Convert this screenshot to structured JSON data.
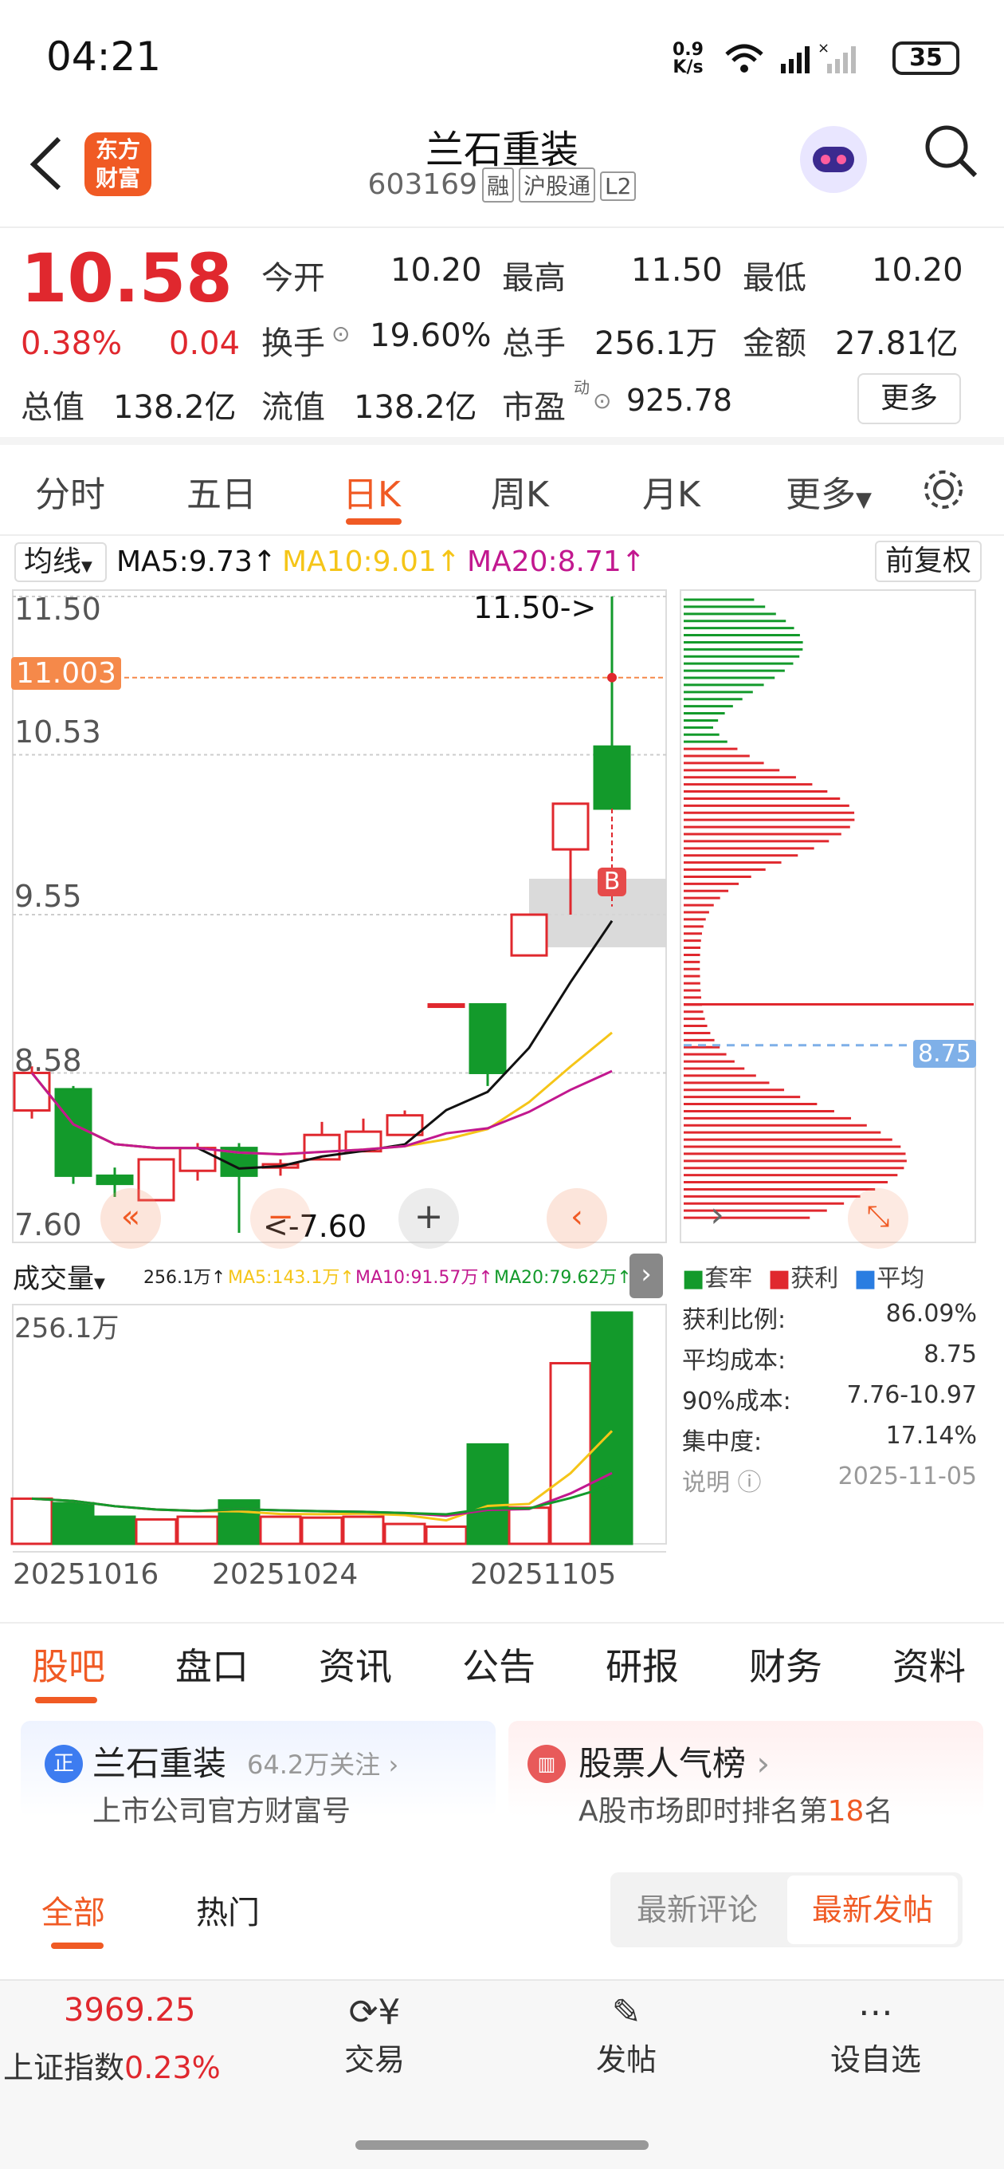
{
  "status": {
    "time": "04:21",
    "net_speed_top": "0.9",
    "net_speed_bottom": "K/s",
    "battery": "35"
  },
  "header": {
    "logo_line1": "东方",
    "logo_line2": "财富",
    "title": "兰石重装",
    "code": "603169",
    "tags": [
      "融",
      "沪股通",
      "L2"
    ]
  },
  "quote": {
    "price": "10.58",
    "change_pct": "0.38%",
    "change_amt": "0.04",
    "open_label": "今开",
    "open": "10.20",
    "high_label": "最高",
    "high": "11.50",
    "low_label": "最低",
    "low": "10.20",
    "turnover_label": "换手",
    "turnover": "19.60%",
    "volume_label": "总手",
    "volume": "256.1万",
    "amount_label": "金额",
    "amount": "27.81亿",
    "mktcap_label": "总值",
    "mktcap": "138.2亿",
    "float_label": "流值",
    "float_cap": "138.2亿",
    "pe_label": "市盈",
    "pe_sup": "动",
    "pe": "925.78",
    "more_label": "更多"
  },
  "ktabs": [
    "分时",
    "五日",
    "日K",
    "周K",
    "月K",
    "更多"
  ],
  "ma_bar": {
    "selector": "均线",
    "ma5": "MA5:9.73",
    "ma10": "MA10:9.01",
    "ma20": "MA20:8.71",
    "adjust": "前复权"
  },
  "price_axis": {
    "p1": "11.50",
    "p2": "10.53",
    "p3": "9.55",
    "p4": "8.58",
    "p5": "7.60",
    "crosshair": "11.003",
    "high_note": "11.50->",
    "low_note": "<-7.60",
    "marker": "B",
    "avg_cost_label": "8.75"
  },
  "vol_bar": {
    "selector": "成交量",
    "v": "256.1万",
    "ma5": "MA5:143.1万",
    "ma10": "MA10:91.57万",
    "ma20": "MA20:79.62万",
    "axis_top": "256.1万"
  },
  "x_labels": [
    "20251016",
    "20251024",
    "20251105"
  ],
  "chip": {
    "legend": [
      "套牢",
      "获利",
      "平均"
    ],
    "rows": [
      {
        "label": "获利比例:",
        "value": "86.09%"
      },
      {
        "label": "平均成本:",
        "value": "8.75"
      },
      {
        "label": "90%成本:",
        "value": "7.76-10.97"
      },
      {
        "label": "集中度:",
        "value": "17.14%"
      }
    ],
    "note_label": "说明",
    "date": "2025-11-05"
  },
  "colors": {
    "up": "#e0282e",
    "down": "#139a2b",
    "accent": "#f05a24",
    "ma5": "#111111",
    "ma10": "#f5c518",
    "ma20": "#c2188f"
  },
  "chart_data": {
    "type": "candlestick",
    "categories": [
      "20251016",
      "",
      "",
      "",
      "",
      "",
      "20251024",
      "",
      "",
      "",
      "",
      "",
      "20251105",
      "",
      ""
    ],
    "series": [
      {
        "name": "K",
        "ohlc": [
          [
            8.35,
            8.58,
            8.3,
            8.62
          ],
          [
            8.48,
            7.95,
            7.9,
            8.5
          ],
          [
            7.95,
            7.9,
            7.82,
            8.0
          ],
          [
            7.8,
            8.05,
            7.8,
            8.05
          ],
          [
            7.98,
            8.12,
            7.92,
            8.15
          ],
          [
            8.12,
            7.95,
            7.6,
            8.15
          ],
          [
            8.0,
            8.02,
            7.95,
            8.05
          ],
          [
            8.05,
            8.2,
            8.05,
            8.28
          ],
          [
            8.1,
            8.22,
            8.1,
            8.3
          ],
          [
            8.2,
            8.32,
            8.2,
            8.35
          ],
          [
            9.0,
            9.0,
            9.0,
            9.0
          ],
          [
            9.0,
            8.58,
            8.5,
            9.0
          ],
          [
            9.3,
            9.55,
            9.3,
            9.55
          ],
          [
            9.95,
            10.23,
            9.55,
            10.23
          ],
          [
            10.58,
            10.2,
            10.2,
            11.5
          ]
        ]
      },
      {
        "name": "成交量",
        "values": [
          50,
          45,
          30,
          27,
          30,
          48,
          30,
          29,
          30,
          22,
          19,
          110,
          40,
          200,
          256.1
        ]
      }
    ],
    "ylim": [
      7.6,
      11.5
    ]
  },
  "tabs2": [
    "股吧",
    "盘口",
    "资讯",
    "公告",
    "研报",
    "财务",
    "资料"
  ],
  "cards": {
    "left_icon": "正",
    "left_title": "兰石重装",
    "left_followers": "64.2万关注",
    "left_sub": "上市公司官方财富号",
    "right_title": "股票人气榜",
    "right_sub_prefix": "A股市场即时排名第",
    "right_rank": "18",
    "right_sub_suffix": "名"
  },
  "filter": {
    "all": "全部",
    "hot": "热门",
    "latest_comment": "最新评论",
    "latest_post": "最新发帖"
  },
  "bottom": {
    "index_value": "3969.25",
    "index_name": "上证指数",
    "index_pct": "0.23%",
    "trade": "交易",
    "post": "发帖",
    "watch": "设自选"
  }
}
